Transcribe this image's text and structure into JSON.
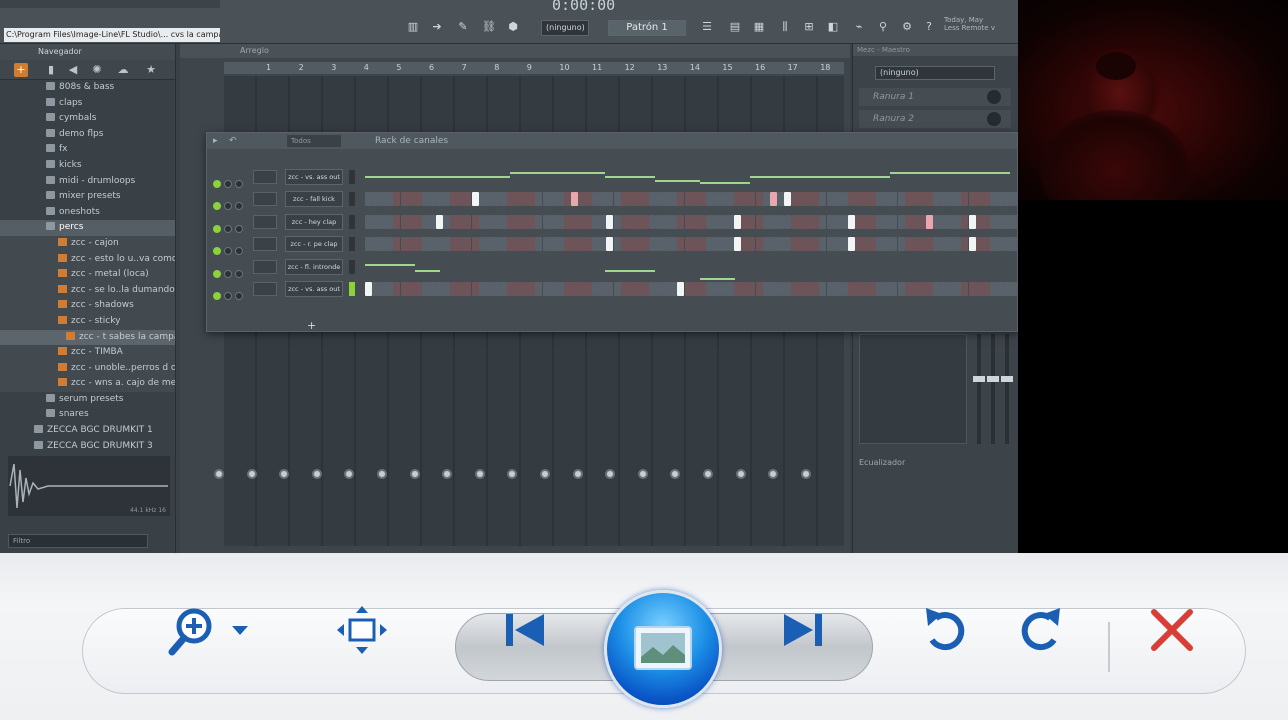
{
  "fl": {
    "path": "C:\\Program Files\\Image-Line\\FL Studio\\... cvs la campana cagon.mov",
    "time": "0:00:00",
    "pattern": "Patrón 1",
    "ninguno": "(ninguno)",
    "hint": "Today, May\nLess Remote v",
    "browser_title": "Navegador",
    "tree": [
      {
        "label": "808s & bass",
        "type": "folder",
        "indent": 46
      },
      {
        "label": "claps",
        "type": "folder",
        "indent": 46
      },
      {
        "label": "cymbals",
        "type": "folder",
        "indent": 46
      },
      {
        "label": "demo flps",
        "type": "folder",
        "indent": 46
      },
      {
        "label": "fx",
        "type": "folder",
        "indent": 46
      },
      {
        "label": "kicks",
        "type": "folder",
        "indent": 46
      },
      {
        "label": "midi - drumloops",
        "type": "folder",
        "indent": 46
      },
      {
        "label": "mixer presets",
        "type": "folder",
        "indent": 46
      },
      {
        "label": "oneshots",
        "type": "folder",
        "indent": 46
      },
      {
        "label": "percs",
        "type": "folder",
        "indent": 46,
        "sel": true
      },
      {
        "label": "zcc - cajon",
        "type": "file",
        "indent": 58
      },
      {
        "label": "zcc - esto lo u..va como loco",
        "type": "file",
        "indent": 58
      },
      {
        "label": "zcc - metal (loca)",
        "type": "file",
        "indent": 58
      },
      {
        "label": "zcc - se lo..la dumando m",
        "type": "file",
        "indent": 58
      },
      {
        "label": "zcc - shadows",
        "type": "file",
        "indent": 58
      },
      {
        "label": "zcc - sticky",
        "type": "file",
        "indent": 58
      },
      {
        "label": "zcc - t sabes la campana cagon",
        "type": "file",
        "indent": 66,
        "hl": true
      },
      {
        "label": "zcc - TIMBA",
        "type": "file",
        "indent": 58
      },
      {
        "label": "zcc - unoble..perros d onda..",
        "type": "file",
        "indent": 58
      },
      {
        "label": "zcc - wns a. cajo de media",
        "type": "file",
        "indent": 58
      },
      {
        "label": "serum presets",
        "type": "folder",
        "indent": 46
      },
      {
        "label": "snares",
        "type": "folder",
        "indent": 46
      },
      {
        "label": "ZECCA BGC DRUMKIT 1",
        "type": "folder",
        "indent": 34
      },
      {
        "label": "ZECCA BGC DRUMKIT 3",
        "type": "folder",
        "indent": 34
      }
    ],
    "search": "Filtro",
    "wave_info": "44.1 kHz 16",
    "playlist_title": "Arreglo",
    "ruler": [
      "1",
      "2",
      "3",
      "4",
      "5",
      "6",
      "7",
      "8",
      "9",
      "10",
      "11",
      "12",
      "13",
      "14",
      "15",
      "16",
      "17",
      "18"
    ],
    "rack_title": "Rack de canales",
    "rack_swing": "Todos",
    "channels": [
      {
        "name": "zcc - vs. ass out",
        "kind": "auto"
      },
      {
        "name": "zcc - fall kick",
        "kind": "steps",
        "on": [
          15,
          29,
          59
        ],
        "pink": [
          29,
          57
        ]
      },
      {
        "name": "zcc - hey clap",
        "kind": "steps",
        "on": [
          10,
          34,
          52,
          68,
          85
        ],
        "pink": [
          79
        ]
      },
      {
        "name": "zcc - r. pe clap",
        "kind": "steps",
        "on": [
          34,
          52,
          68,
          85
        ]
      },
      {
        "name": "zcc - fl. intronde",
        "kind": "auto2"
      },
      {
        "name": "zcc - vs. ass out",
        "kind": "steps",
        "on": [
          0,
          44
        ]
      }
    ],
    "mixer_title": "Mezc - Maestro",
    "mixer_select": "(ninguno)",
    "slots": [
      "Ranura 1",
      "Ranura 2"
    ],
    "mixer_label": "Ecualizador"
  },
  "viewer": {
    "zoom": "zoom-icon",
    "fit": "fit-window-icon",
    "prev": "previous-icon",
    "slideshow": "slideshow-icon",
    "next": "next-icon",
    "rotate_ccw": "rotate-counterclockwise-icon",
    "rotate_cw": "rotate-clockwise-icon",
    "delete": "delete-icon"
  },
  "colors": {
    "fl_bg": "#3a4147",
    "accent_green": "#8bd23b",
    "accent_orange": "#d07d2f",
    "viewer_blue": "#1c8fe6",
    "delete_red": "#d93d35"
  }
}
